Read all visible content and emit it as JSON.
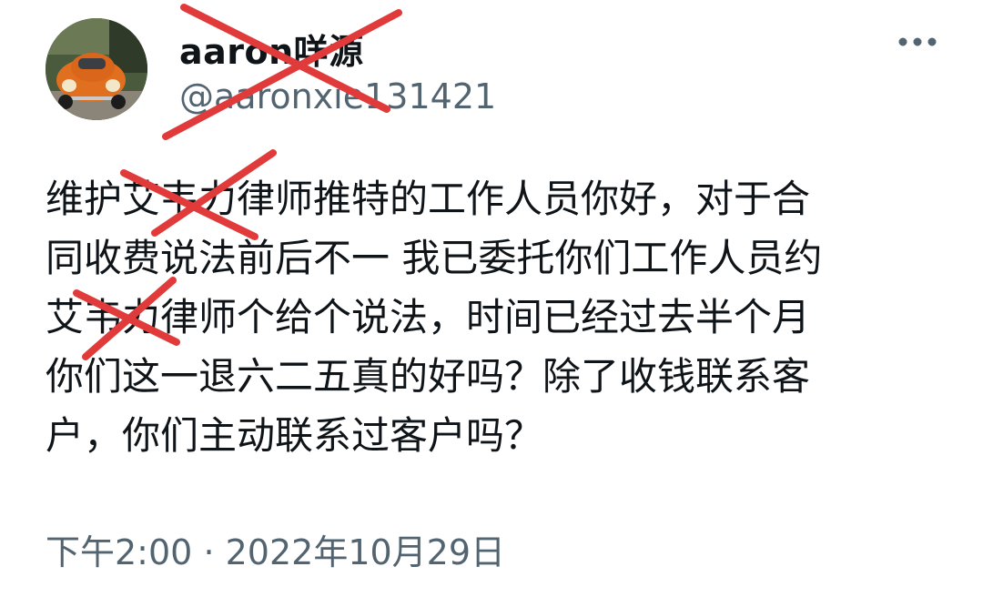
{
  "author": {
    "display_name": "aaron咩源",
    "handle": "@aaronxie131421"
  },
  "tweet": {
    "lines": [
      "维护艾韦力律师推特的工作人员你好，对于合",
      "同收费说法前后不一 我已委托你们工作人员约",
      "艾韦力律师个给个说法，时间已经过去半个月",
      "你们这一退六二五真的好吗？除了收钱联系客",
      "户，你们主动联系过客户吗？"
    ]
  },
  "meta": {
    "time": "下午2:00",
    "separator": "·",
    "date": "2022年10月29日"
  },
  "icons": {
    "more": "more-horizontal-icon",
    "redaction": "red-x-mark"
  },
  "colors": {
    "text": "#0f1419",
    "secondary": "#536471",
    "redaction": "#e13a3a"
  }
}
